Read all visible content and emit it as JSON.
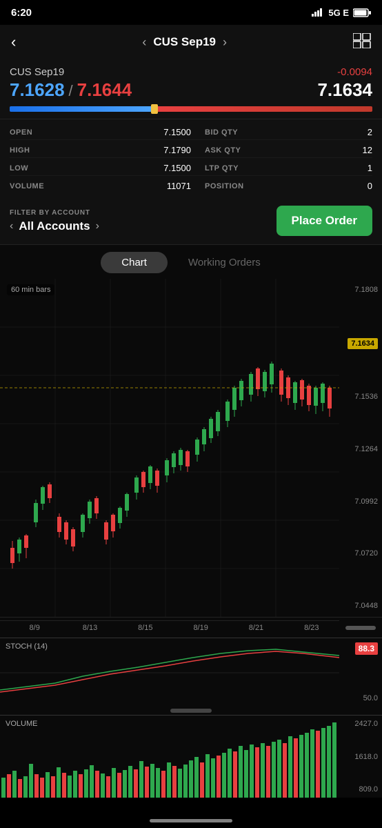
{
  "status": {
    "time": "6:20",
    "signal_bars": "▂▄▆█",
    "network": "5G E",
    "battery": "🔋"
  },
  "nav": {
    "back_label": "‹",
    "title": "CUS Sep19",
    "prev_label": "‹",
    "next_label": "›",
    "grid_label": "⊞"
  },
  "quote": {
    "symbol": "CUS Sep19",
    "change": "-0.0094",
    "bid": "7.1628",
    "ask": "7.1644",
    "last": "7.1634",
    "separator": "/"
  },
  "market_data": {
    "open_label": "OPEN",
    "open_value": "7.1500",
    "high_label": "HIGH",
    "high_value": "7.1790",
    "low_label": "LOW",
    "low_value": "7.1500",
    "volume_label": "VOLUME",
    "volume_value": "11071",
    "bid_qty_label": "BID QTY",
    "bid_qty_value": "2",
    "ask_qty_label": "ASK QTY",
    "ask_qty_value": "12",
    "ltp_qty_label": "LTP QTY",
    "ltp_qty_value": "1",
    "position_label": "POSITION",
    "position_value": "0"
  },
  "filter": {
    "label": "FILTER BY ACCOUNT",
    "account_text": "All Accounts",
    "prev_label": "‹",
    "next_label": "›"
  },
  "buttons": {
    "place_order": "Place Order"
  },
  "chart": {
    "tab_chart": "Chart",
    "tab_working_orders": "Working Orders",
    "time_label": "60 min bars",
    "current_price_label": "7.1634",
    "y_labels": [
      "7.1808",
      "7.1634",
      "7.1536",
      "7.1264",
      "7.0992",
      "7.0720",
      "7.0448"
    ],
    "x_labels": [
      "8/9",
      "8/13",
      "8/15",
      "8/19",
      "8/21",
      "8/23"
    ]
  },
  "stoch": {
    "label": "STOCH (14)",
    "badge_value": "88.3",
    "y_labels": [
      "88.3",
      "50.0"
    ]
  },
  "volume": {
    "label": "VOLUME",
    "y_labels": [
      "2427.0",
      "1618.0",
      "809.0"
    ]
  }
}
